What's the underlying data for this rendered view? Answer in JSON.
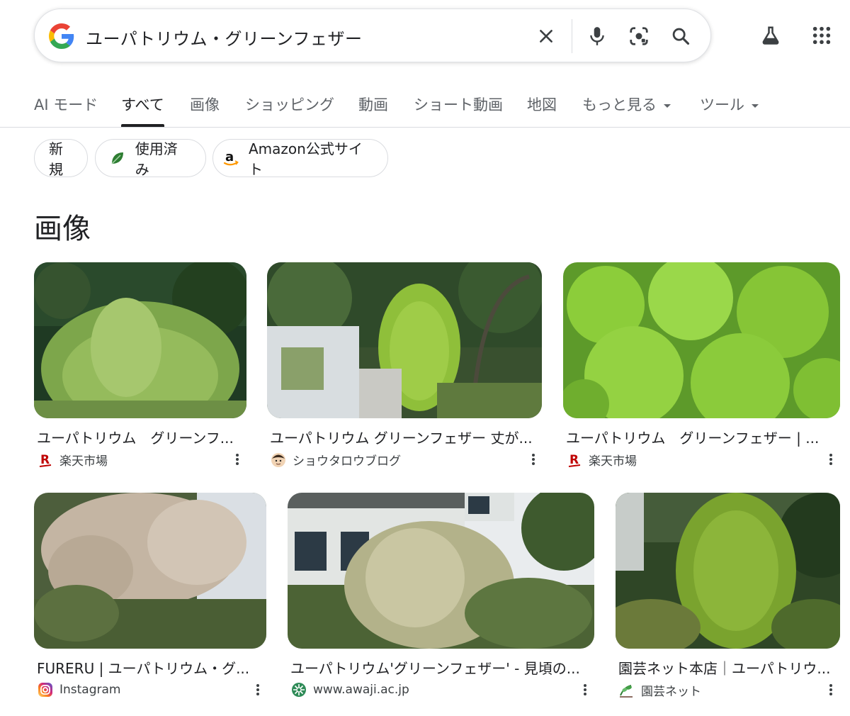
{
  "search": {
    "query": "ユーパトリウム・グリーンフェザー"
  },
  "tabs": [
    {
      "label": "AI モード"
    },
    {
      "label": "すべて"
    },
    {
      "label": "画像"
    },
    {
      "label": "ショッピング"
    },
    {
      "label": "動画"
    },
    {
      "label": "ショート動画"
    },
    {
      "label": "地図"
    },
    {
      "label": "もっと見る"
    },
    {
      "label": "ツール"
    }
  ],
  "chips": [
    {
      "label": "新規"
    },
    {
      "label": "使用済み"
    },
    {
      "label": "Amazon公式サイト"
    }
  ],
  "section": {
    "title": "画像"
  },
  "results": [
    {
      "title": "ユーパトリウム　グリーンフ...",
      "source": "楽天市場",
      "favicon": "rakuten-icon"
    },
    {
      "title": "ユーパトリウム グリーンフェザー 丈が...",
      "source": "ショウタロウブログ",
      "favicon": "avatar-icon"
    },
    {
      "title": "ユーパトリウム　グリーンフェザー | ...",
      "source": "楽天市場",
      "favicon": "rakuten-icon"
    },
    {
      "title": "FURERU | ユーパトリウム・グ...",
      "source": "Instagram",
      "favicon": "instagram-icon"
    },
    {
      "title": "ユーパトリウム'グリーンフェザー' - 見頃の...",
      "source": "www.awaji.ac.jp",
      "favicon": "awaji-icon"
    },
    {
      "title": "園芸ネット本店｜ユーパトリウ...",
      "source": "園芸ネット",
      "favicon": "engei-icon"
    }
  ],
  "colors": {
    "google_blue": "#4285F4",
    "google_red": "#EA4335",
    "google_yellow": "#FBBC05",
    "google_green": "#34A853",
    "rakuten_red": "#BF0000"
  }
}
